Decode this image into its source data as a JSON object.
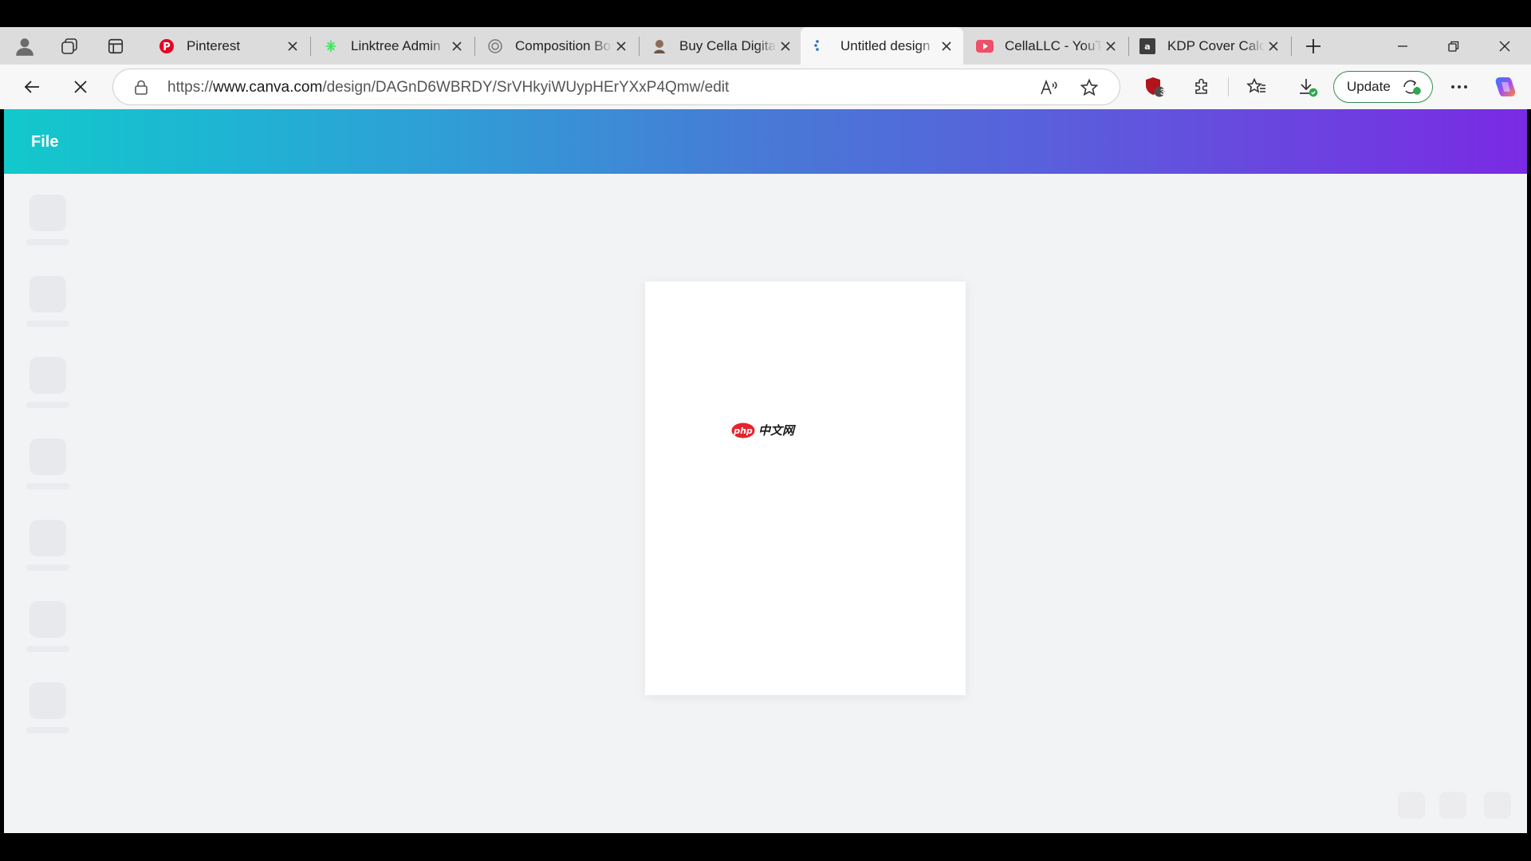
{
  "browser": {
    "tabs": [
      {
        "title": "Pinterest",
        "icon": "pinterest-icon",
        "active": false
      },
      {
        "title": "Linktree Admin",
        "icon": "linktree-icon",
        "active": false
      },
      {
        "title": "Composition Bo",
        "icon": "globe-icon",
        "active": false
      },
      {
        "title": "Buy Cella Digita",
        "icon": "site-icon",
        "active": false
      },
      {
        "title": "Untitled design",
        "icon": "loading-icon",
        "active": true
      },
      {
        "title": "CellaLLC - YouT",
        "icon": "youtube-icon",
        "active": false
      },
      {
        "title": "KDP Cover Calc",
        "icon": "amazon-icon",
        "active": false
      }
    ],
    "url": {
      "scheme": "https://",
      "host": "www.canva.com",
      "path": "/design/DAGnD6WBRDY/SrVHkyiWUypHErYXxP4Qmw/edit"
    },
    "extension_badge": "3",
    "update_label": "Update",
    "colors": {
      "update_border": "#2f8f4e",
      "tab_strip": "#dcdcdc",
      "toolbar": "#f7f7f7"
    }
  },
  "canva": {
    "menu": {
      "file_label": "File"
    },
    "watermark": {
      "badge": "php",
      "text": "中文网"
    },
    "colors": {
      "gradient_start": "#12c9cb",
      "gradient_end": "#7a2ae4",
      "canvas_bg": "#f2f3f5"
    }
  }
}
